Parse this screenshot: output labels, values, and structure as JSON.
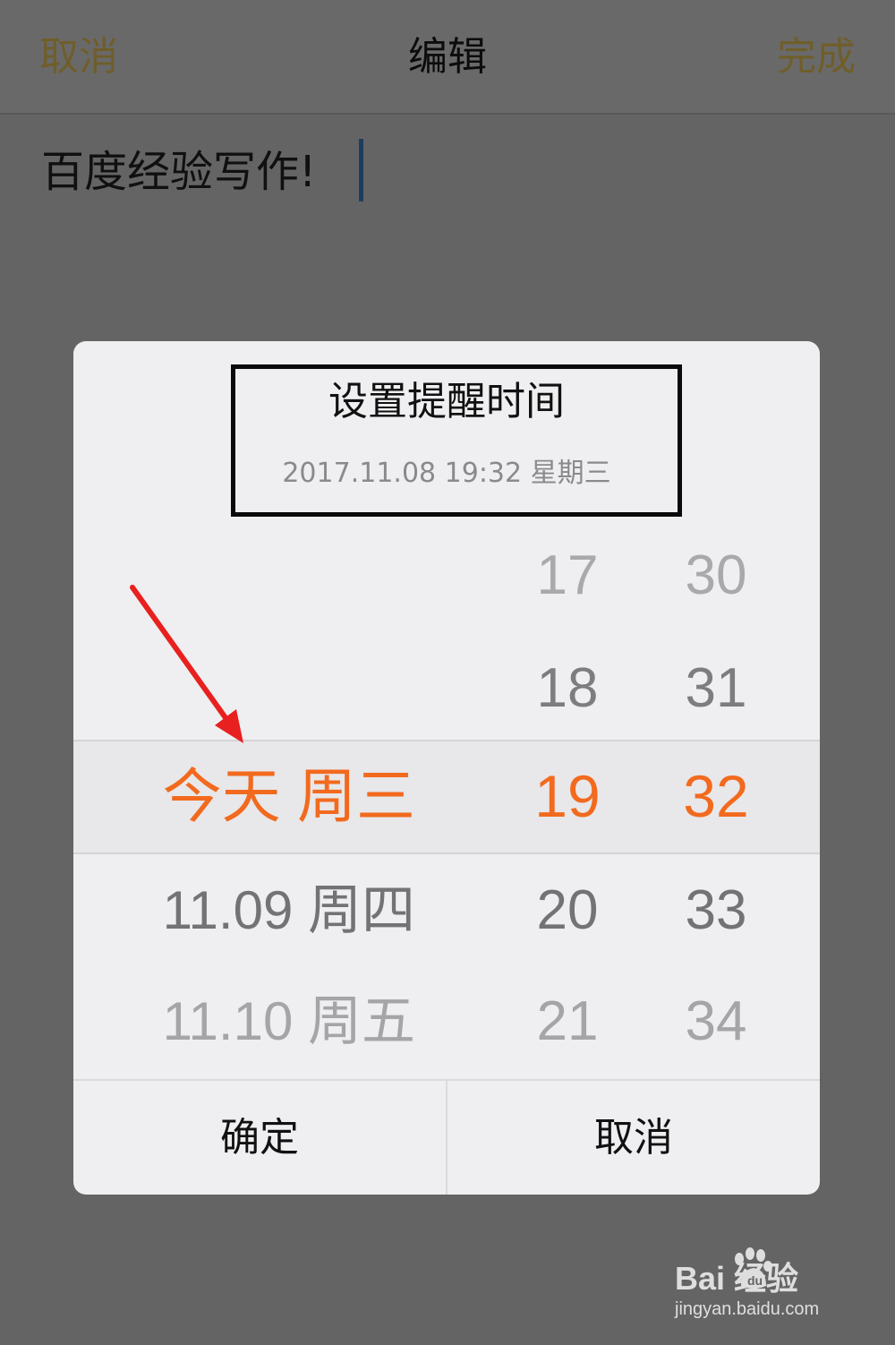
{
  "navbar": {
    "left_label": "取消",
    "title": "编辑",
    "right_label": "完成"
  },
  "editor": {
    "content": "百度经验写作!"
  },
  "dialog": {
    "title": "设置提醒时间",
    "subtitle": "2017.11.08  19:32 星期三",
    "picker": {
      "dates": [
        "",
        "",
        "今天 周三",
        "11.09 周四",
        "11.10 周五"
      ],
      "hours": [
        "17",
        "18",
        "19",
        "20",
        "21"
      ],
      "minutes": [
        "30",
        "31",
        "32",
        "33",
        "34"
      ],
      "selected_index": 2
    },
    "confirm_label": "确定",
    "cancel_label": "取消"
  },
  "colors": {
    "accent": "#f26a1e",
    "nav_button": "#6f5e2a",
    "annotation_arrow": "#e8201f"
  },
  "watermark": {
    "brand": "Bai  经验",
    "url": "jingyan.baidu.com",
    "icon": "baidu-paw-icon"
  }
}
